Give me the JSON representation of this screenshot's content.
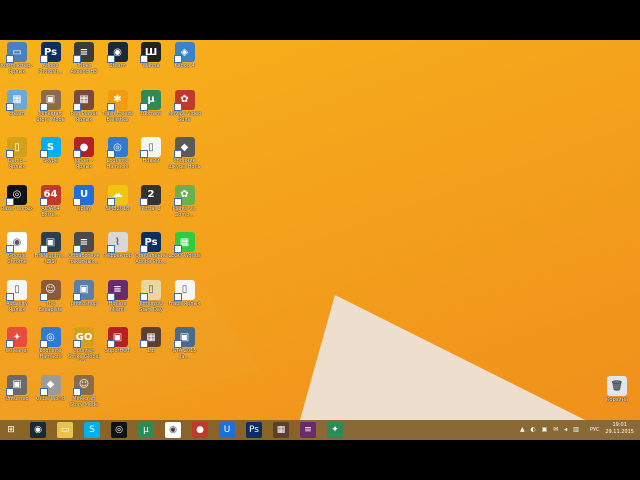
{
  "desktop_icons": [
    {
      "label": "Компьютер - Ярлык",
      "color": "#4a7fc0",
      "glyph": "▭"
    },
    {
      "label": "Adobe Photosh...",
      "color": "#0b2f5f",
      "glyph": "Ps"
    },
    {
      "label": "Tribes Ascend H5",
      "color": "#3b3b3b",
      "glyph": "≡"
    },
    {
      "label": "Steam",
      "color": "#1b2838",
      "glyph": "◉"
    },
    {
      "label": "Wanna",
      "color": "#222",
      "glyph": "Ш"
    },
    {
      "label": "Kaboo 4",
      "color": "#3a83c9",
      "glyph": "◈"
    },
    {
      "label": "cream",
      "color": "#6aa8d8",
      "glyph": "▦"
    },
    {
      "label": "Minecraft Story Mode",
      "color": "#8b6b4a",
      "glyph": "▣"
    },
    {
      "label": "Rad Planet Ярлык",
      "color": "#7a4a3a",
      "glyph": "▦"
    },
    {
      "label": "Trash Freeze Ballistics",
      "color": "#f39c12",
      "glyph": "✱"
    },
    {
      "label": "uTorrent",
      "color": "#2e8b57",
      "glyph": "µ"
    },
    {
      "label": "Movavi Video Suite",
      "color": "#c0392b",
      "glyph": "✿"
    },
    {
      "label": "Demo - Ярлык",
      "color": "#d4a017",
      "glyph": "▯"
    },
    {
      "label": "Skype",
      "color": "#00aff0",
      "glyph": "S"
    },
    {
      "label": "Jorsen - Ярлык",
      "color": "#b22222",
      "glyph": "●"
    },
    {
      "label": "Loquinte Hamachi",
      "color": "#2f7bd1",
      "glyph": "◎"
    },
    {
      "label": "Новый",
      "color": "#f5f5f5",
      "glyph": "▯"
    },
    {
      "label": "Сборник шкуры Ноль",
      "color": "#5a5a5a",
      "glyph": "◆"
    },
    {
      "label": "Razer Cortex",
      "color": "#111",
      "glyph": "◎"
    },
    {
      "label": "AIDA64 Extre...",
      "color": "#c0392b",
      "glyph": "64"
    },
    {
      "label": "Uplay",
      "color": "#1e6fd9",
      "glyph": "U"
    },
    {
      "label": "SMB2018",
      "color": "#f1c40f",
      "glyph": "☁"
    },
    {
      "label": "Portal 2",
      "color": "#333",
      "glyph": "2"
    },
    {
      "label": "Plants vs. Zomb...",
      "color": "#6ab04c",
      "glyph": "✿"
    },
    {
      "label": "Google Chrome",
      "color": "#ffffff",
      "glyph": "◉"
    },
    {
      "label": "FireNightm...(ZIS)",
      "color": "#2c3e50",
      "glyph": "▣"
    },
    {
      "label": "Обработчик пакетных...",
      "color": "#4b4b4b",
      "glyph": "≡"
    },
    {
      "label": "Рефрактор",
      "color": "#d8d8d8",
      "glyph": "⌇"
    },
    {
      "label": "Обновление Adobe Pho...",
      "color": "#0b2f5f",
      "glyph": "Ps"
    },
    {
      "label": "LEGO Worlds",
      "color": "#2ecc40",
      "glyph": "▦"
    },
    {
      "label": "Audacity Ярлык",
      "color": "#f5f5f5",
      "glyph": "▯"
    },
    {
      "label": "The Escapists",
      "color": "#8e5b3a",
      "glyph": "☺"
    },
    {
      "label": "photoshop",
      "color": "#5a7fa8",
      "glyph": "▣"
    },
    {
      "label": "Hotline Miami",
      "color": "#6b2a6b",
      "glyph": "≡"
    },
    {
      "label": "Tomorrow Start Day",
      "color": "#e8d8a0",
      "glyph": "▯"
    },
    {
      "label": "Fraps Ярлык",
      "color": "#f5f5f5",
      "glyph": "▯"
    },
    {
      "label": "CCleaner",
      "color": "#e74c3c",
      "glyph": "✦"
    },
    {
      "label": "Loquinte Hamachi",
      "color": "#2f7bd1",
      "glyph": "◎"
    },
    {
      "label": "Counter-Strike Global Off...",
      "color": "#d4a017",
      "glyph": "GO"
    },
    {
      "label": "SuperHOT",
      "color": "#b22222",
      "glyph": "▣"
    },
    {
      "label": "1.8",
      "color": "#5b4030",
      "glyph": "▦"
    },
    {
      "label": "GTA 2015 Ja...",
      "color": "#4a6a8a",
      "glyph": "▣"
    },
    {
      "label": "Unturned",
      "color": "#6a6a6a",
      "glyph": "▣"
    },
    {
      "label": "Cube World",
      "color": "#9b9b9b",
      "glyph": "◆"
    },
    {
      "label": "Minecraft Story Mode",
      "color": "#8b6b4a",
      "glyph": "☺"
    }
  ],
  "recycle_bin": {
    "label": "Корзина"
  },
  "taskbar": {
    "items": [
      {
        "name": "start",
        "glyph": "⊞",
        "color": "transparent"
      },
      {
        "name": "steam",
        "glyph": "◉",
        "color": "#1b2838"
      },
      {
        "name": "explorer",
        "glyph": "▭",
        "color": "#e8c24a"
      },
      {
        "name": "skype",
        "glyph": "S",
        "color": "#00aff0"
      },
      {
        "name": "razer",
        "glyph": "◎",
        "color": "#111"
      },
      {
        "name": "utorrent",
        "glyph": "µ",
        "color": "#2e8b57"
      },
      {
        "name": "chrome",
        "glyph": "◉",
        "color": "#ffffff"
      },
      {
        "name": "record",
        "glyph": "●",
        "color": "#c0392b"
      },
      {
        "name": "uplay",
        "glyph": "U",
        "color": "#1e6fd9"
      },
      {
        "name": "photoshop",
        "glyph": "Ps",
        "color": "#0b2f5f"
      },
      {
        "name": "minecraft",
        "glyph": "▦",
        "color": "#5b4030"
      },
      {
        "name": "winrar",
        "glyph": "≡",
        "color": "#6b2a6b"
      },
      {
        "name": "leaf",
        "glyph": "✦",
        "color": "#2e8b57"
      }
    ],
    "lang": "РУС",
    "time": "19:01",
    "date": "29.11.2015"
  }
}
